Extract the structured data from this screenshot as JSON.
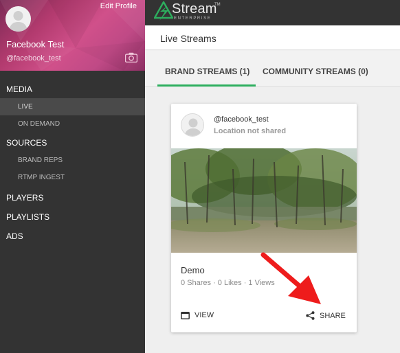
{
  "profile": {
    "edit_label": "Edit Profile",
    "name": "Facebook Test",
    "handle": "@facebook_test"
  },
  "brand": {
    "name": "Stream",
    "trademark": "TM",
    "edition": "ENTERPRISE",
    "accent_color": "#2dae5e"
  },
  "nav": {
    "media": "MEDIA",
    "live": "LIVE",
    "on_demand": "ON DEMAND",
    "sources": "SOURCES",
    "brand_reps": "BRAND REPS",
    "rtmp_ingest": "RTMP INGEST",
    "players": "PLAYERS",
    "playlists": "PLAYLISTS",
    "ads": "ADS"
  },
  "page": {
    "title": "Live Streams"
  },
  "tabs": {
    "brand": "BRAND STREAMS (1)",
    "community": "COMMUNITY STREAMS (0)"
  },
  "card": {
    "user": "@facebook_test",
    "location": "Location not shared",
    "title": "Demo",
    "stats": "0 Shares · 0 Likes · 1 Views",
    "view_label": "VIEW",
    "share_label": "SHARE"
  },
  "icons": [
    "camera-icon",
    "stream-logo-icon",
    "view-icon",
    "share-icon",
    "avatar-placeholder-icon"
  ],
  "annotation": {
    "arrow_color": "#ee1c1c"
  }
}
